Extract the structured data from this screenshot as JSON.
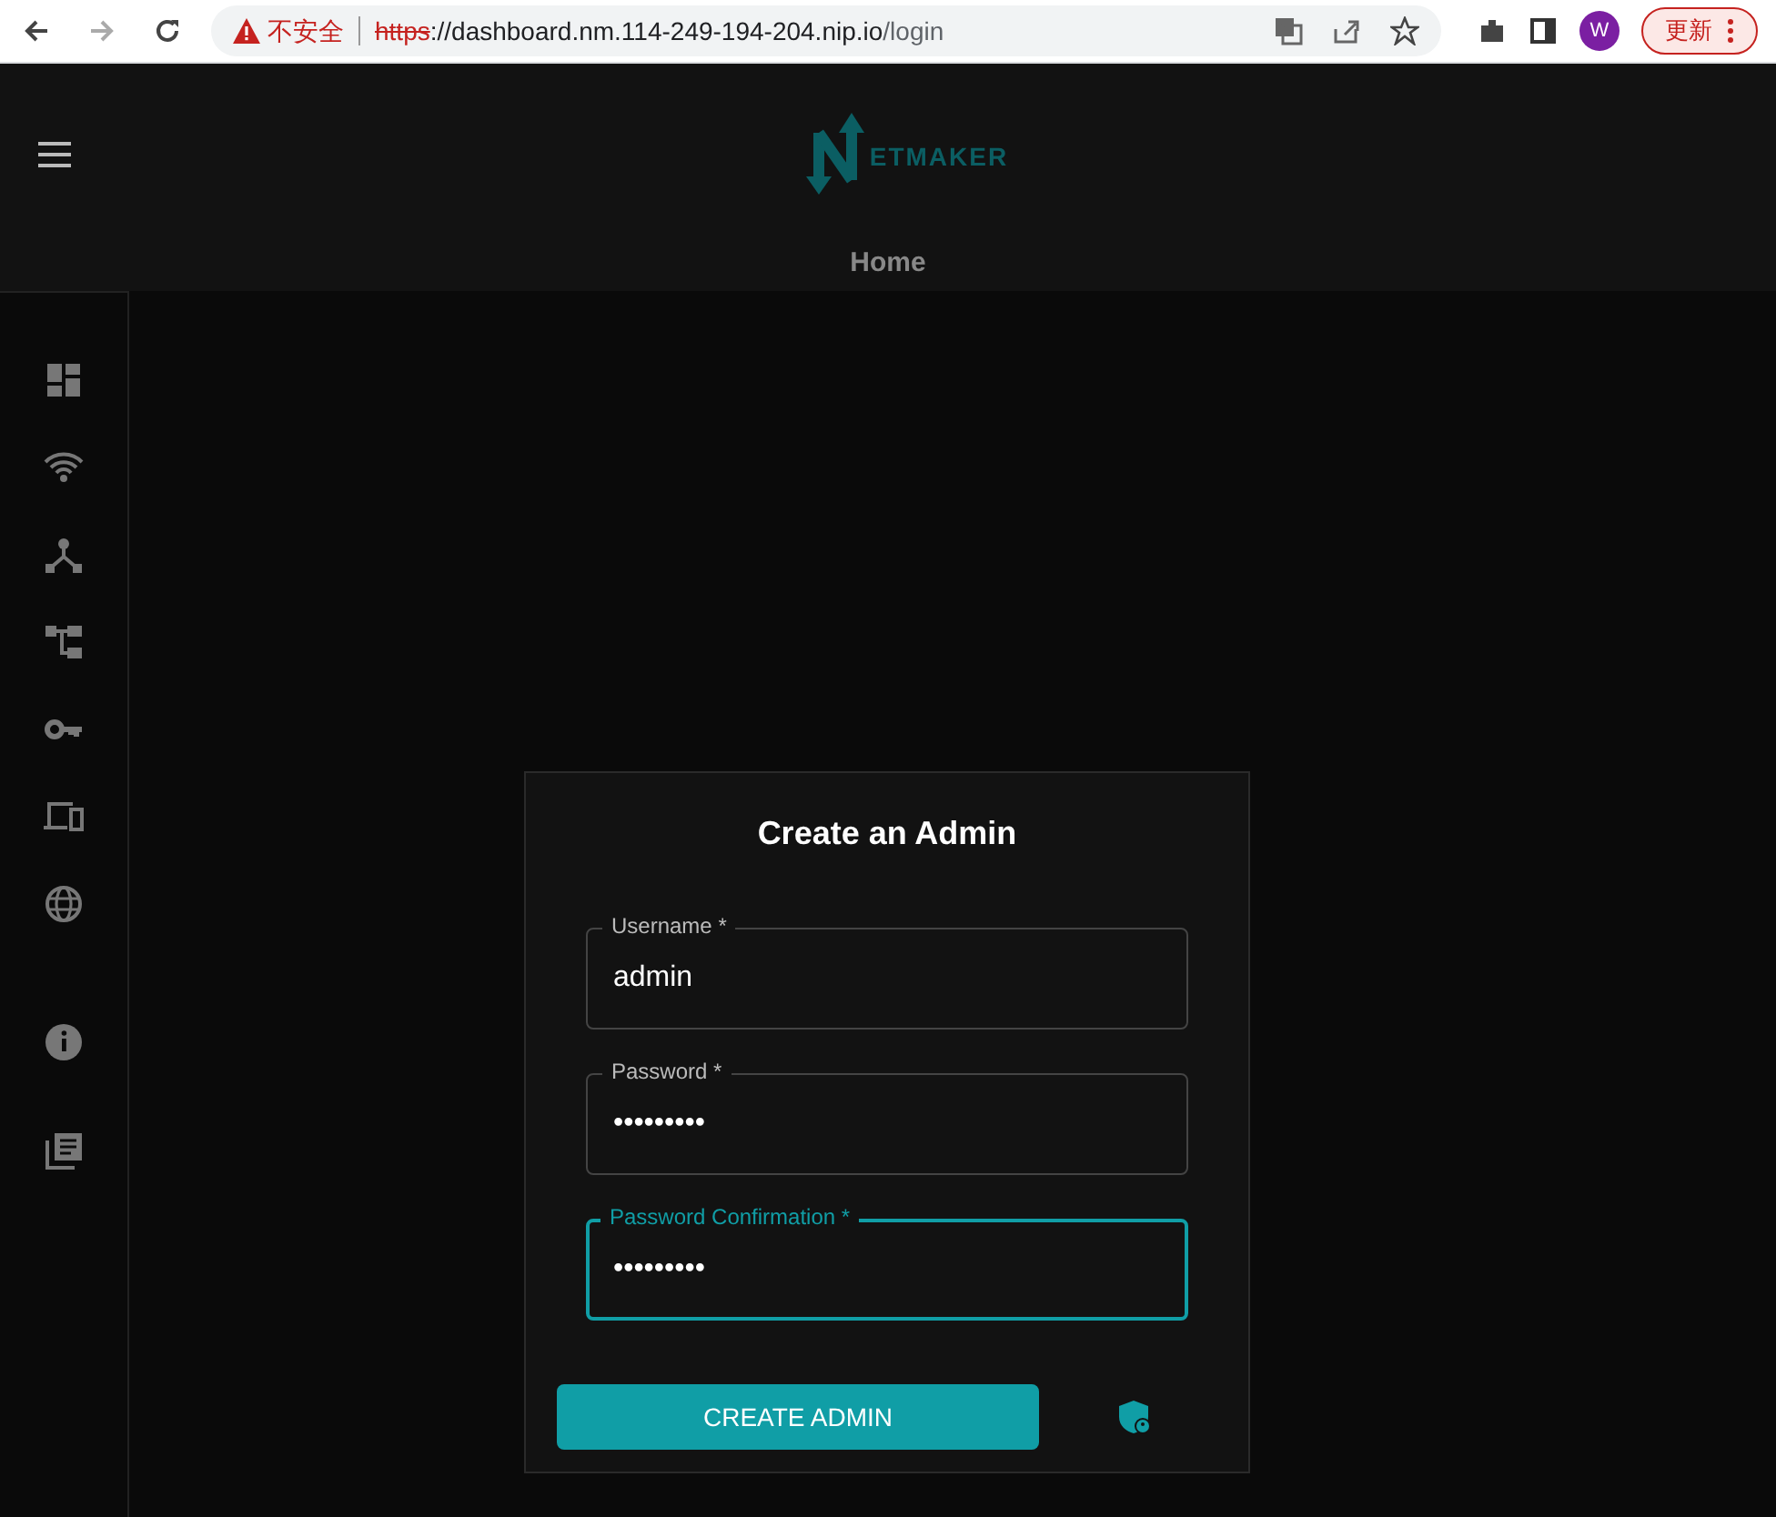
{
  "browser": {
    "security_label": "不安全",
    "url_scheme": "https",
    "url_host": "://dashboard.nm.114-249-194-204.nip.io",
    "url_path": "/login",
    "profile_initial": "W",
    "update_label": "更新"
  },
  "header": {
    "logo_text": "ETMAKER",
    "page_title": "Home"
  },
  "form": {
    "title": "Create an Admin",
    "fields": [
      {
        "label": "Username *",
        "value": "admin",
        "focused": false
      },
      {
        "label": "Password *",
        "value": "•••••••••",
        "focused": false
      },
      {
        "label": "Password Confirmation *",
        "value": "•••••••••",
        "focused": true
      }
    ],
    "submit": "CREATE ADMIN"
  }
}
